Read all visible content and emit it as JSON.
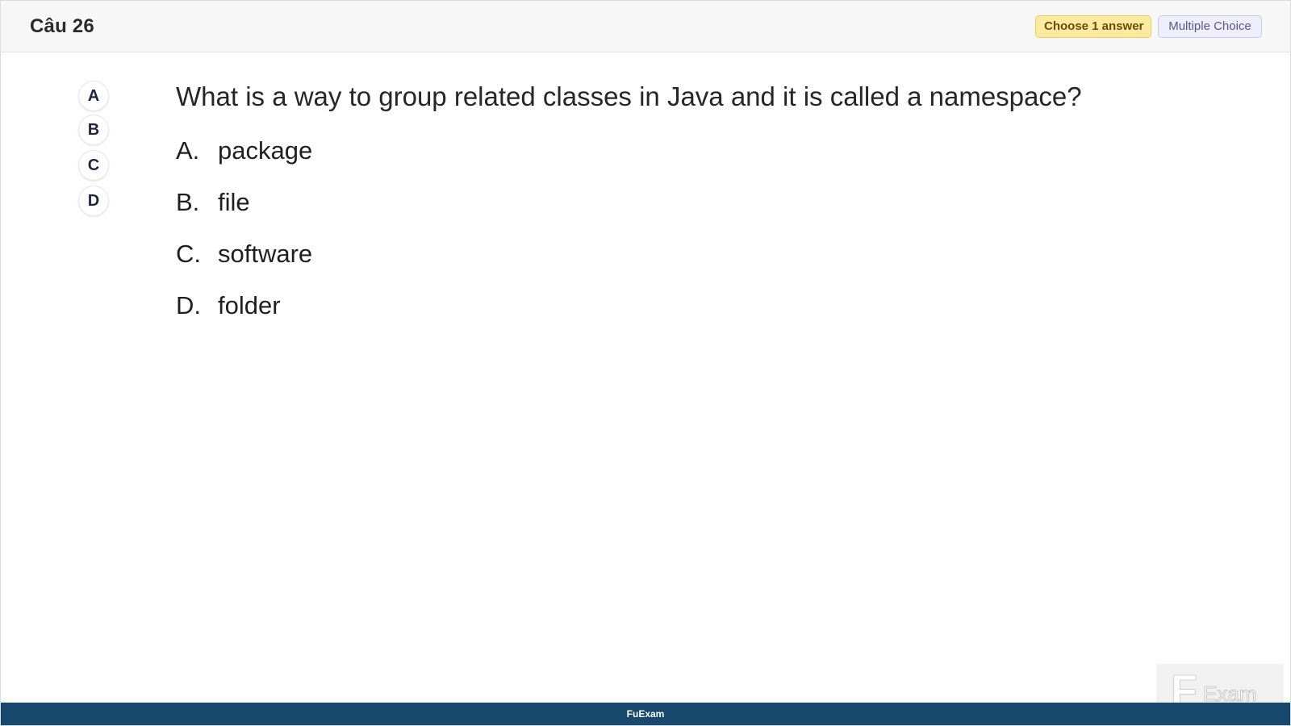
{
  "header": {
    "question_number": "Câu 26",
    "choose_badge": "Choose 1 answer",
    "type_badge": "Multiple Choice"
  },
  "selectors": [
    "A",
    "B",
    "C",
    "D"
  ],
  "question": {
    "text": "What is a way to group related classes in Java and it is called a namespace?"
  },
  "options": [
    {
      "letter": "A.",
      "text": "package"
    },
    {
      "letter": "B.",
      "text": "file"
    },
    {
      "letter": "C.",
      "text": "software"
    },
    {
      "letter": "D.",
      "text": "folder"
    }
  ],
  "footer": {
    "brand": "FuExam"
  },
  "watermark": {
    "f": "F",
    "exam": "Exam"
  }
}
